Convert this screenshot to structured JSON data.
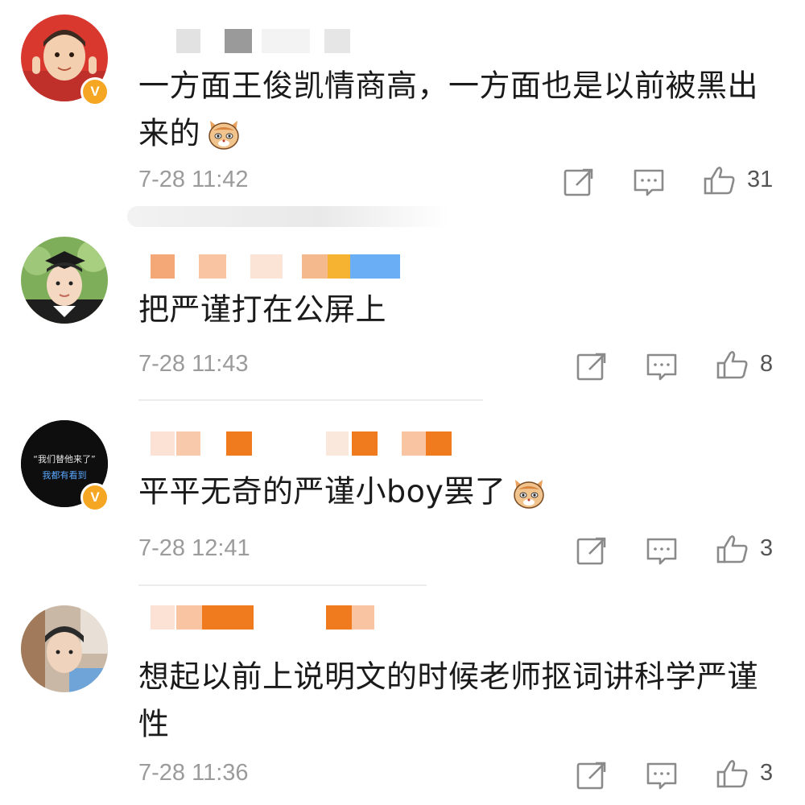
{
  "comments": [
    {
      "text": "一方面王俊凯情商高，一方面也是以前被黑出来的",
      "has_emoji": true,
      "emoji": "cat-face-emoji",
      "time": "7-28 11:42",
      "likes": "31",
      "verified_badge": "V"
    },
    {
      "text": "把严谨打在公屏上",
      "has_emoji": false,
      "time": "7-28 11:43",
      "likes": "8"
    },
    {
      "text": "平平无奇的严谨小boy罢了",
      "has_emoji": true,
      "emoji": "cat-face-emoji",
      "time": "7-28 12:41",
      "likes": "3",
      "verified_badge": "V",
      "avatar_text_line1": "“我们替他来了”",
      "avatar_text_line2": "我都有看到"
    },
    {
      "text": "想起以前上说明文的时候老师抠词讲科学严谨性",
      "has_emoji": false,
      "time": "7-28 11:36",
      "likes": "3"
    }
  ],
  "icons": {
    "share": "share-icon",
    "comment": "comment-icon",
    "like": "thumbs-up-icon",
    "verified": "verified-badge"
  },
  "colors": {
    "badge": "#f5a623",
    "username_redaction": "#f07a1e",
    "timestamp": "#9b9b9b",
    "icon": "#8a8a8a"
  }
}
